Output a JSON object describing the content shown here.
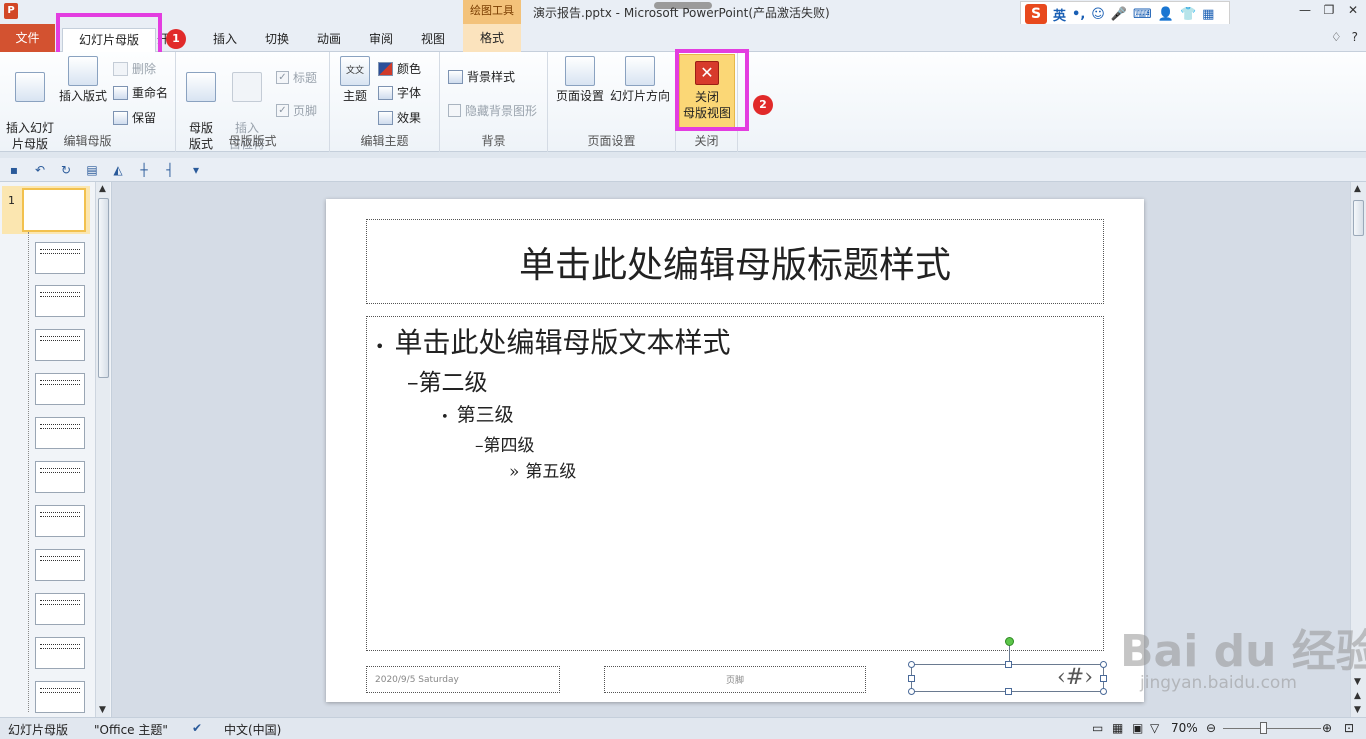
{
  "title_bar": {
    "app_icon": "P",
    "context_tool_label": "绘图工具",
    "title": "演示报告.pptx - Microsoft PowerPoint(产品激活失败)",
    "window_buttons": [
      "—",
      "❐",
      "✕"
    ]
  },
  "ime": {
    "logo": "S",
    "items": [
      "英",
      "•,",
      "☺",
      "🎤",
      "⌨",
      "👤",
      "👕",
      "▦"
    ]
  },
  "tabs": {
    "file": "文件",
    "items": [
      "幻灯片母版",
      "开",
      "插入",
      "切换",
      "动画",
      "审阅",
      "视图"
    ],
    "context_tab": "格式",
    "help": [
      "♢",
      "?"
    ]
  },
  "badges": [
    "1",
    "2"
  ],
  "ribbon": {
    "edit_master": {
      "label": "编辑母版",
      "insert_slide_master": "插入幻灯\n片母版",
      "insert_layout": "插入版式",
      "delete": "删除",
      "rename": "重命名",
      "preserve": "保留"
    },
    "master_layout": {
      "label": "母版版式",
      "master_layout_btn": "母版\n版式",
      "insert_placeholder": "插入\n占位符",
      "title_check": "标题",
      "footer_check": "页脚"
    },
    "edit_theme": {
      "label": "编辑主题",
      "themes": "主题",
      "theme_glyph": "文文",
      "colors": "颜色",
      "fonts": "字体",
      "effects": "效果"
    },
    "background": {
      "label": "背景",
      "bg_styles": "背景样式",
      "hide_bg": "隐藏背景图形"
    },
    "page_setup": {
      "label": "页面设置",
      "page_setup_btn": "页面设置",
      "orientation": "幻灯片方向"
    },
    "close": {
      "label": "关闭",
      "close_master": "关闭\n母版视图"
    }
  },
  "slide": {
    "title": "单击此处编辑母版标题样式",
    "levels": [
      "单击此处编辑母版文本样式",
      "第二级",
      "第三级",
      "第四级",
      "第五级"
    ],
    "bullets": [
      "•",
      "–",
      "•",
      "–",
      "»"
    ],
    "footer_date": "2020/9/5 Saturday",
    "footer_text": "页脚",
    "slide_number": "‹#›"
  },
  "thumbnails": {
    "selected_number": "1",
    "count": 12
  },
  "watermark": {
    "main": "Bai du 经验",
    "sub": "jingyan.baidu.com"
  },
  "status_bar": {
    "mode": "幻灯片母版",
    "theme": "\"Office 主题\"",
    "language": "中文(中国)",
    "zoom": "70%",
    "zoom_level": 0.42
  }
}
